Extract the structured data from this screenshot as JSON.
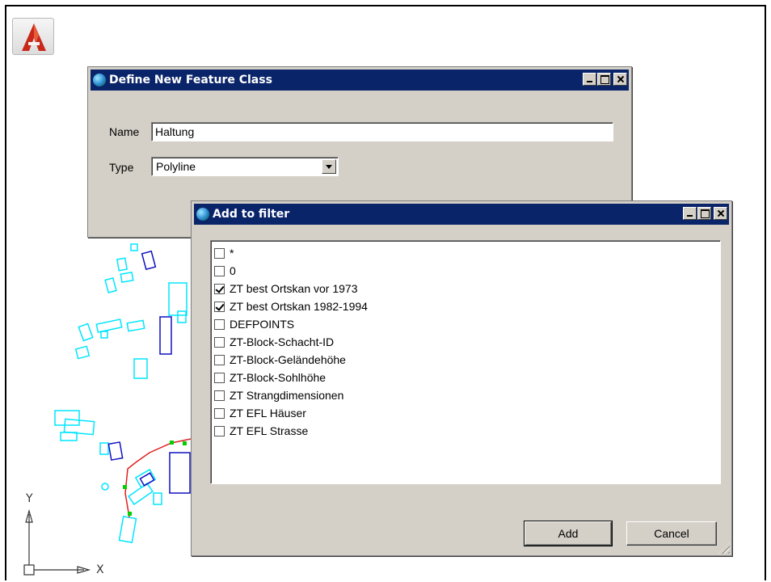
{
  "define_dialog": {
    "title": "Define New Feature Class",
    "name_label": "Name",
    "name_value": "Haltung",
    "type_label": "Type",
    "type_value": "Polyline"
  },
  "filter_dialog": {
    "title": "Add to filter",
    "items": [
      {
        "label": "*",
        "checked": false
      },
      {
        "label": "0",
        "checked": false
      },
      {
        "label": "ZT best Ortskan vor 1973",
        "checked": true
      },
      {
        "label": "ZT best Ortskan 1982-1994",
        "checked": true
      },
      {
        "label": "DEFPOINTS",
        "checked": false
      },
      {
        "label": "ZT-Block-Schacht-ID",
        "checked": false
      },
      {
        "label": "ZT-Block-Geländehöhe",
        "checked": false
      },
      {
        "label": "ZT-Block-Sohlhöhe",
        "checked": false
      },
      {
        "label": "ZT Strangdimensionen",
        "checked": false
      },
      {
        "label": "ZT EFL Häuser",
        "checked": false
      },
      {
        "label": "ZT EFL Strasse",
        "checked": false
      }
    ],
    "add_label": "Add",
    "cancel_label": "Cancel"
  },
  "ucs": {
    "x_label": "X",
    "y_label": "Y"
  },
  "colors": {
    "titlebar": "#0a246a",
    "dialog_bg": "#d4d0c8",
    "cyan": "#00e5ff",
    "blue": "#1010c0",
    "red": "#e02020",
    "green": "#00d000"
  }
}
